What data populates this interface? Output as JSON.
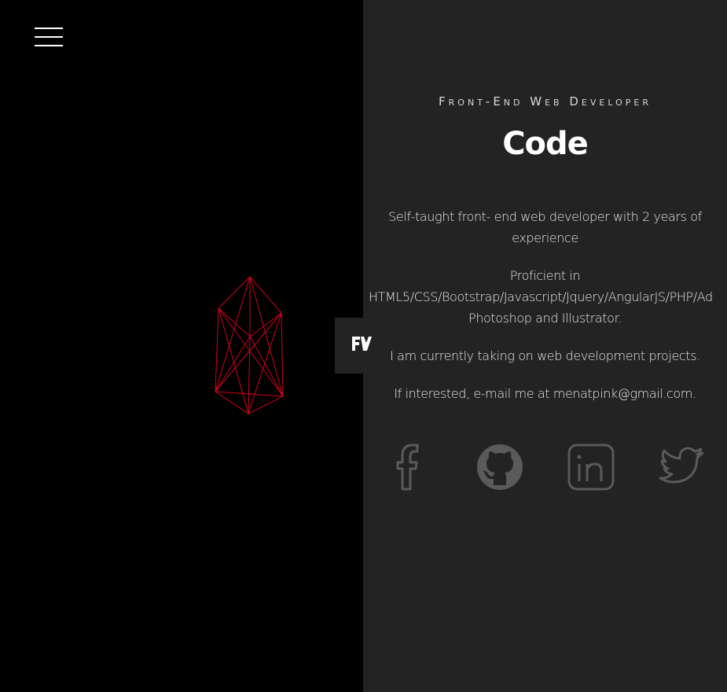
{
  "nav": {
    "menu_icon": "hamburger-menu-icon"
  },
  "hero": {
    "graphic": "wireframe-crystal-icon",
    "graphic_color": "#d0021b"
  },
  "toggle": {
    "icon": "logo-toggle-icon"
  },
  "profile": {
    "subtitle": "Front-End Web Developer",
    "title": "Code",
    "intro_line1": "Self-taught front- end web developer with 2 years of",
    "intro_line2": "experience",
    "skills_line1": "Proficient in",
    "skills_line2": "HTML5/CSS/Bootstrap/Javascript/Jquery/AngularJS/PHP/Ad",
    "skills_line3": "Photoshop and Illustrator.",
    "availability": "I am currently taking on web development projects.",
    "contact": "If interested, e-mail me at menatpink@gmail.com."
  },
  "social": [
    {
      "name": "facebook-icon"
    },
    {
      "name": "github-icon"
    },
    {
      "name": "linkedin-icon"
    },
    {
      "name": "twitter-icon"
    }
  ],
  "colors": {
    "left_bg": "#000000",
    "right_bg": "#232323",
    "icon_gray": "#5a5a5a",
    "text": "#e6e6e6"
  }
}
